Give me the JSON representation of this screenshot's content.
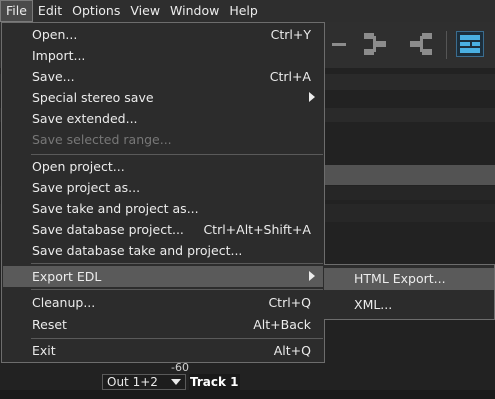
{
  "menubar": {
    "items": [
      {
        "label": "File",
        "active": true
      },
      {
        "label": "Edit"
      },
      {
        "label": "Options"
      },
      {
        "label": "View"
      },
      {
        "label": "Window"
      },
      {
        "label": "Help"
      }
    ]
  },
  "file_menu": {
    "items": [
      {
        "label": "Open...",
        "shortcut": "Ctrl+Y"
      },
      {
        "label": "Import...",
        "shortcut": ""
      },
      {
        "label": "Save...",
        "shortcut": "Ctrl+A"
      },
      {
        "label": "Special stereo save",
        "shortcut": "",
        "submenu": true
      },
      {
        "label": "Save extended...",
        "shortcut": ""
      },
      {
        "label": "Save selected range...",
        "shortcut": "",
        "disabled": true
      },
      {
        "label": "Open project...",
        "shortcut": ""
      },
      {
        "label": "Save project as...",
        "shortcut": ""
      },
      {
        "label": "Save take and project as...",
        "shortcut": ""
      },
      {
        "label": "Save database project...",
        "shortcut": "Ctrl+Alt+Shift+A"
      },
      {
        "label": "Save database take and project...",
        "shortcut": ""
      },
      {
        "label": "Export EDL",
        "shortcut": "",
        "submenu": true,
        "highlighted": true
      },
      {
        "label": "Cleanup...",
        "shortcut": "Ctrl+Q"
      },
      {
        "label": "Reset",
        "shortcut": "Alt+Back"
      },
      {
        "label": "Exit",
        "shortcut": "Alt+Q"
      }
    ]
  },
  "export_edl_submenu": {
    "items": [
      {
        "label": "HTML Export...",
        "highlighted": true
      },
      {
        "label": "XML..."
      }
    ]
  },
  "track": {
    "level": "-60",
    "output": "Out 1+2",
    "name": "Track 1"
  },
  "colors": {
    "menu_bg": "#2c2c2c",
    "highlight": "#5a5a5a",
    "accent_icon": "#4ab0e2"
  }
}
